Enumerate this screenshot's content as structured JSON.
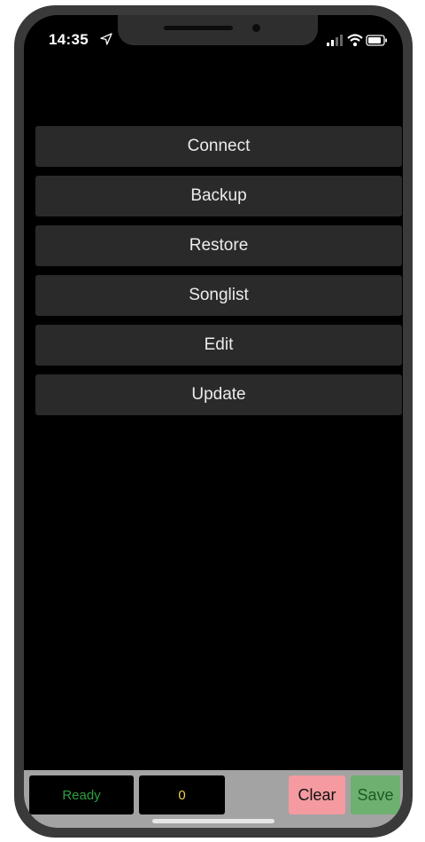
{
  "status_bar": {
    "time": "14:35",
    "icons": [
      "location-arrow-icon",
      "cellular-signal-icon",
      "wifi-icon",
      "battery-icon"
    ]
  },
  "menu": {
    "items": [
      {
        "label": "Connect"
      },
      {
        "label": "Backup"
      },
      {
        "label": "Restore"
      },
      {
        "label": "Songlist"
      },
      {
        "label": "Edit"
      },
      {
        "label": "Update"
      }
    ]
  },
  "bottom_bar": {
    "status_text": "Ready",
    "count": "0",
    "clear_label": "Clear",
    "save_label": "Save"
  },
  "colors": {
    "background": "#000000",
    "button_bg": "#2a2a2a",
    "bottom_bar_bg": "#a3a3a3",
    "status_text": "#2f9e40",
    "count_text": "#f0d050",
    "clear_bg": "#f49aa0",
    "save_bg": "#6db070"
  }
}
